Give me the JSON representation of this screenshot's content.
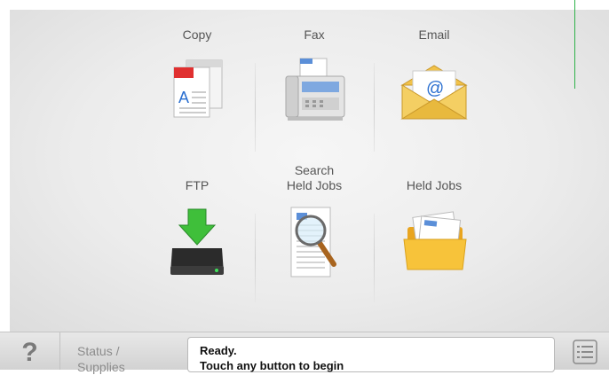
{
  "home": {
    "tiles": [
      {
        "id": "copy",
        "label": "Copy",
        "icon": "copy-icon"
      },
      {
        "id": "fax",
        "label": "Fax",
        "icon": "fax-icon"
      },
      {
        "id": "email",
        "label": "Email",
        "icon": "email-icon"
      },
      {
        "id": "ftp",
        "label": "FTP",
        "icon": "ftp-icon"
      },
      {
        "id": "search-held-jobs",
        "label": "Search\nHeld Jobs",
        "icon": "search-held-jobs-icon"
      },
      {
        "id": "held-jobs",
        "label": "Held Jobs",
        "icon": "held-jobs-icon"
      }
    ]
  },
  "bottom_bar": {
    "help_label": "?",
    "status_line1": "Status /",
    "status_line2": "Supplies",
    "message_line1": "Ready.",
    "message_line2": "Touch any button to begin",
    "menu_icon": "menu-list-icon"
  },
  "colors": {
    "indicator": "#2fb24a",
    "ftp_arrow": "#3fbf3a",
    "email_envelope": "#f1c24a",
    "folder": "#f7c33a"
  }
}
